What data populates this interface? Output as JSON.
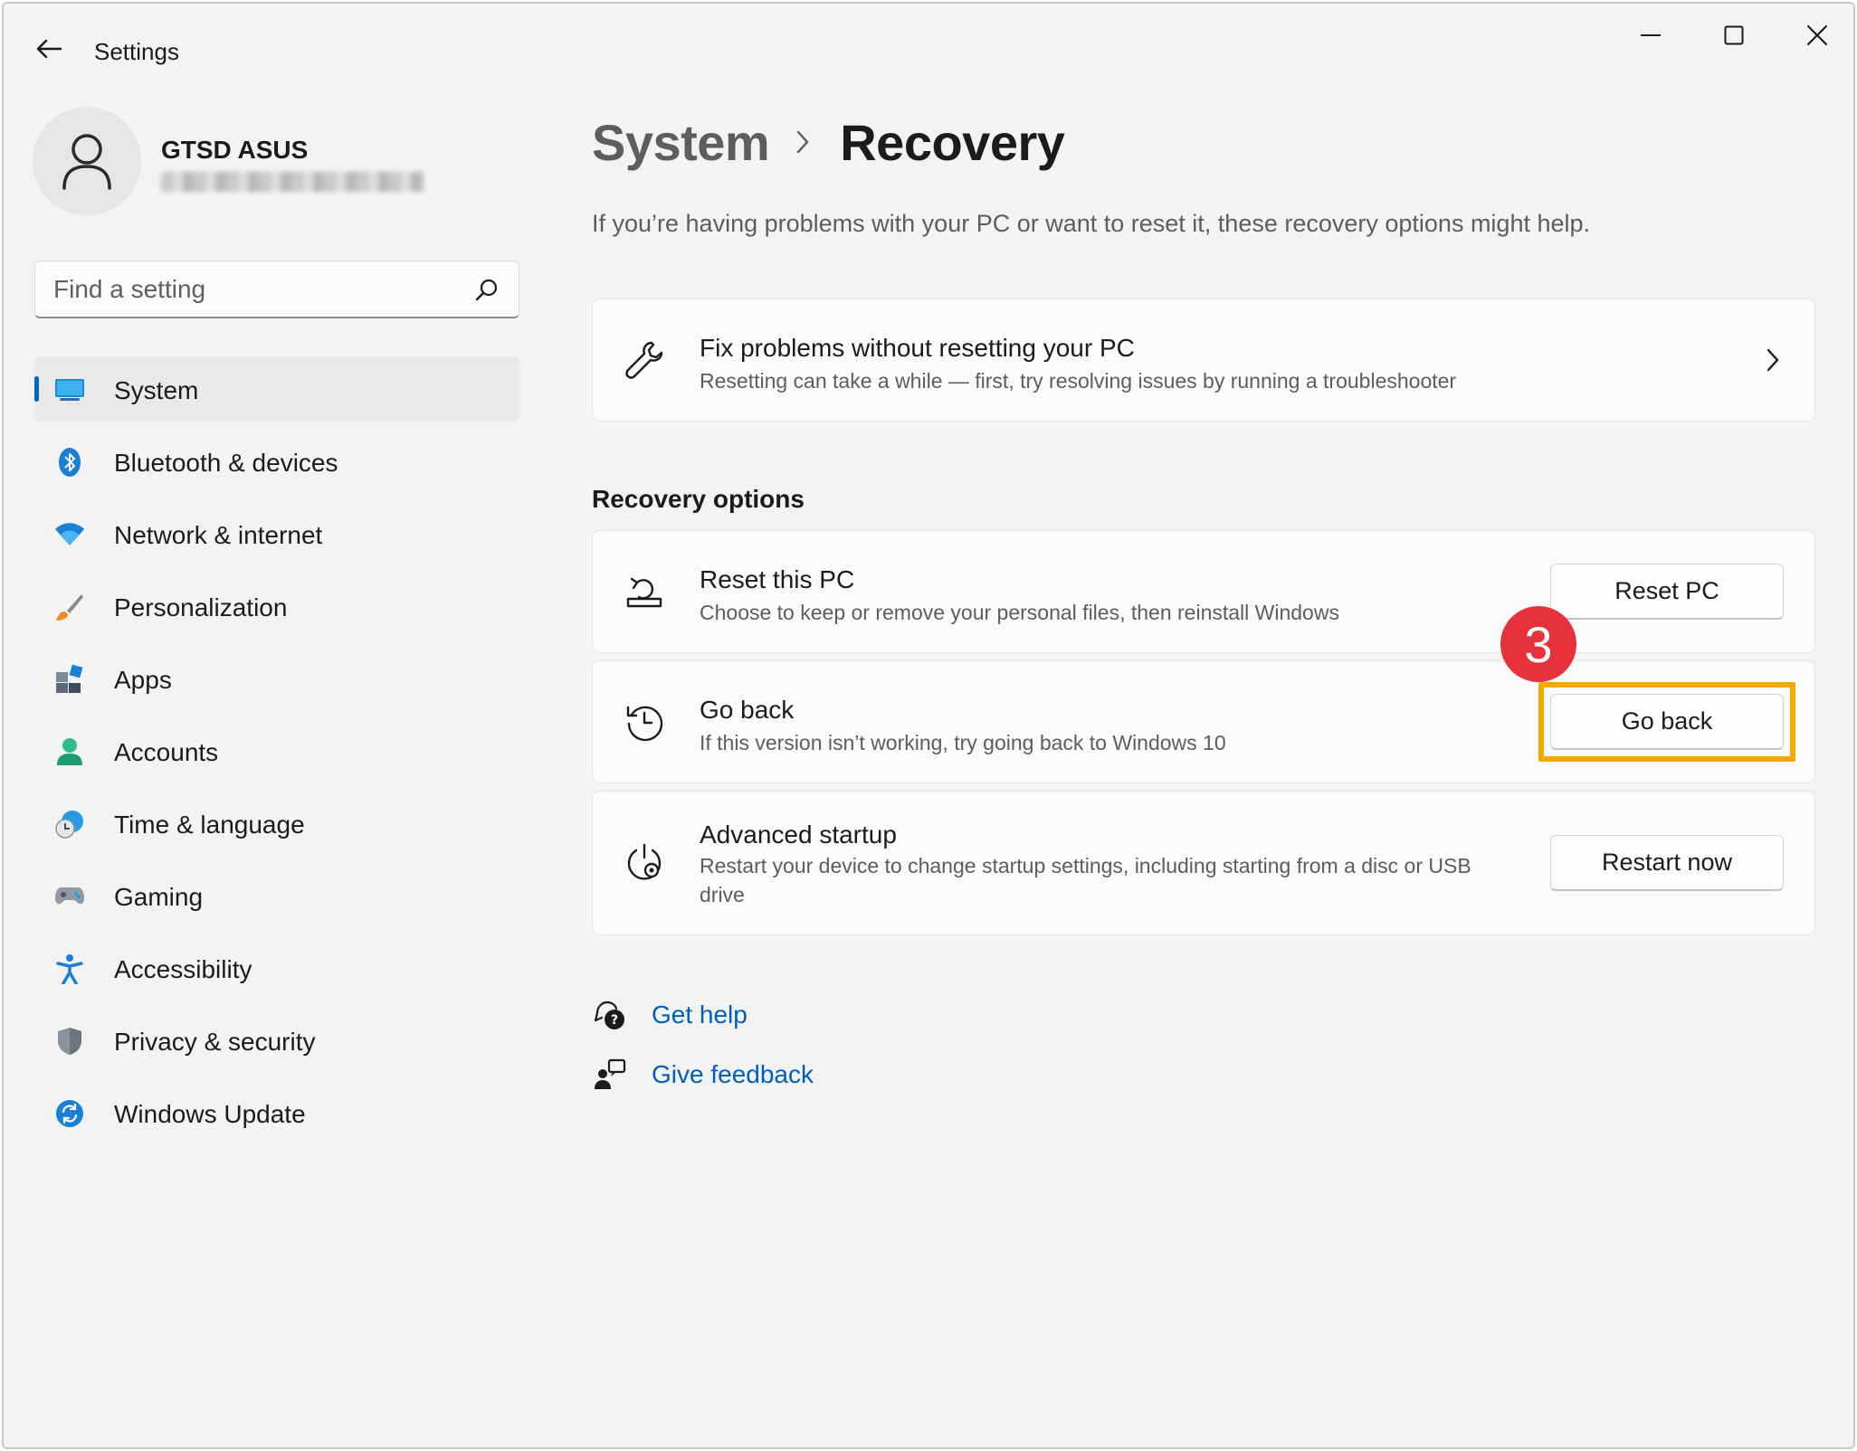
{
  "window": {
    "title": "Settings"
  },
  "profile": {
    "name": "GTSD ASUS",
    "email": "••••• ••••••••••••••••"
  },
  "search": {
    "placeholder": "Find a setting"
  },
  "sidebar": {
    "items": [
      {
        "label": "System",
        "icon": "system-icon",
        "active": true
      },
      {
        "label": "Bluetooth & devices",
        "icon": "bluetooth-icon"
      },
      {
        "label": "Network & internet",
        "icon": "wifi-icon"
      },
      {
        "label": "Personalization",
        "icon": "brush-icon"
      },
      {
        "label": "Apps",
        "icon": "apps-icon"
      },
      {
        "label": "Accounts",
        "icon": "accounts-icon"
      },
      {
        "label": "Time & language",
        "icon": "clock-globe-icon"
      },
      {
        "label": "Gaming",
        "icon": "gamepad-icon"
      },
      {
        "label": "Accessibility",
        "icon": "accessibility-icon"
      },
      {
        "label": "Privacy & security",
        "icon": "shield-icon"
      },
      {
        "label": "Windows Update",
        "icon": "update-icon"
      }
    ]
  },
  "main": {
    "breadcrumb_parent": "System",
    "breadcrumb_current": "Recovery",
    "intro": "If you’re having problems with your PC or want to reset it, these recovery options might help.",
    "fix_card": {
      "title": "Fix problems without resetting your PC",
      "desc": "Resetting can take a while — first, try resolving issues by running a troubleshooter"
    },
    "section_title": "Recovery options",
    "reset_card": {
      "title": "Reset this PC",
      "desc": "Choose to keep or remove your personal files, then reinstall Windows",
      "button": "Reset PC"
    },
    "goback_card": {
      "title": "Go back",
      "desc": "If this version isn’t working, try going back to Windows 10",
      "button": "Go back"
    },
    "advanced_card": {
      "title": "Advanced startup",
      "desc": "Restart your device to change startup settings, including starting from a disc or USB drive",
      "button": "Restart now"
    },
    "links": {
      "get_help": "Get help",
      "give_feedback": "Give feedback"
    }
  },
  "annotation": {
    "step_number": "3",
    "highlight_color": "#f2a900",
    "badge_color": "#e8323a"
  },
  "colors": {
    "accent": "#0067c0",
    "link": "#005fb8",
    "background": "#f3f3f3",
    "card": "#fbfbfb"
  }
}
